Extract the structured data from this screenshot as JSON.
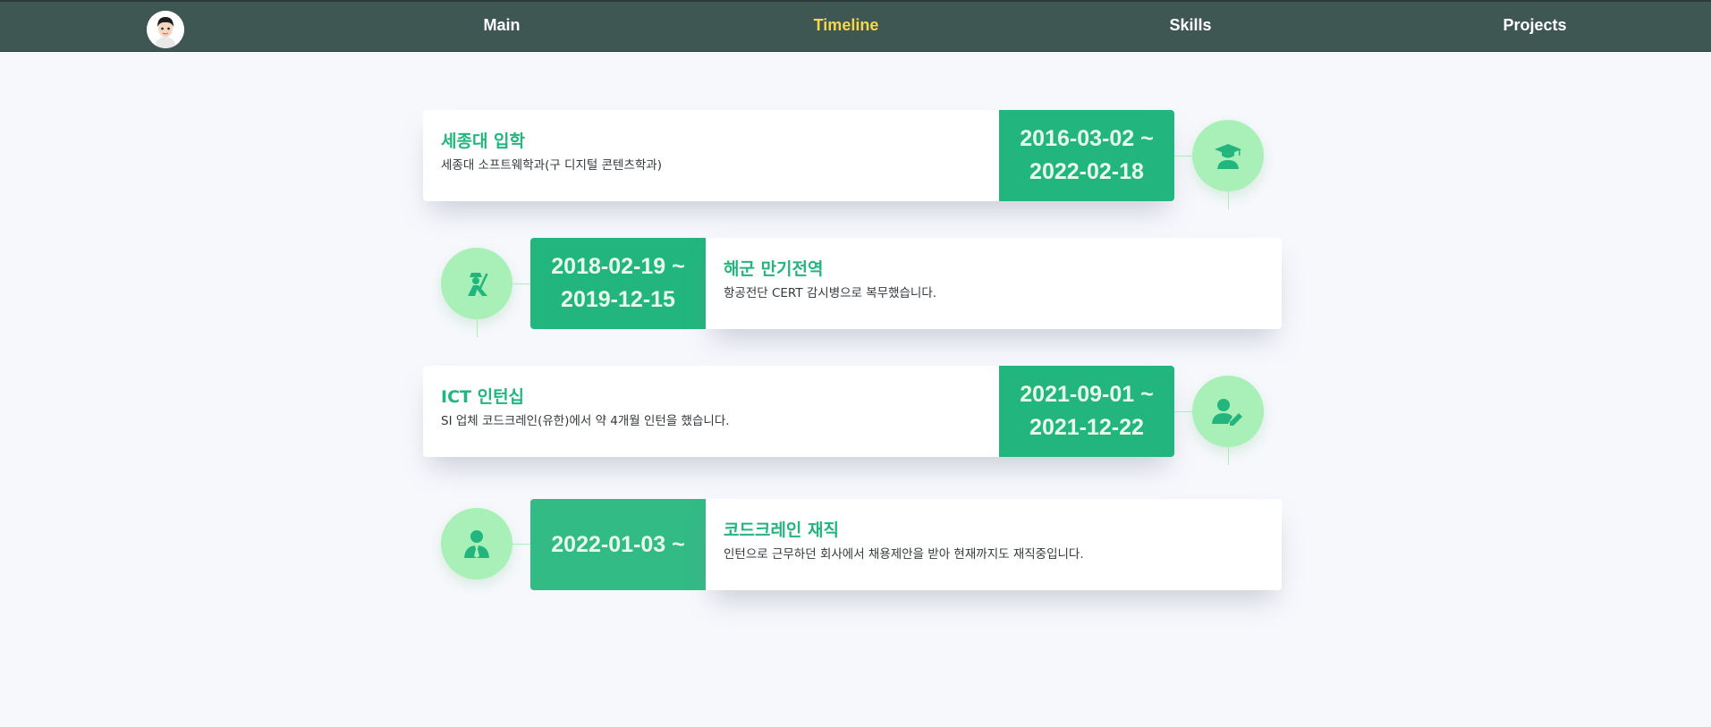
{
  "nav": {
    "items": [
      {
        "label": "Main",
        "active": false
      },
      {
        "label": "Timeline",
        "active": true
      },
      {
        "label": "Skills",
        "active": false
      },
      {
        "label": "Projects",
        "active": false
      }
    ]
  },
  "timeline": [
    {
      "title": "세종대 입학",
      "desc": "세종대 소프트웨학과(구 디지털 콘텐츠학과)",
      "date_start": "2016-03-02 ~",
      "date_end": "2022-02-18",
      "icon": "graduate-icon"
    },
    {
      "title": "해군 만기전역",
      "desc": "항공전단 CERT 감시병으로 복무했습니다.",
      "date_start": "2018-02-19 ~",
      "date_end": "2019-12-15",
      "icon": "soldier-icon"
    },
    {
      "title": "ICT 인턴십",
      "desc": "SI 업체 코드크레인(유한)에서 약 4개월 인턴을 했습니다.",
      "date_start": "2021-09-01 ~",
      "date_end": "2021-12-22",
      "icon": "user-edit-icon"
    },
    {
      "title": "코드크레인 재직",
      "desc": "인턴으로 근무하던 회사에서 채용제안을 받아 현재까지도 재직중입니다.",
      "date_start": "2022-01-03 ~",
      "date_end": "",
      "icon": "businessman-icon"
    }
  ],
  "colors": {
    "navbar": "#3f5752",
    "accent": "#22b67e",
    "active_nav": "#f5d84a",
    "icon_circle": "#a8f0b8"
  }
}
